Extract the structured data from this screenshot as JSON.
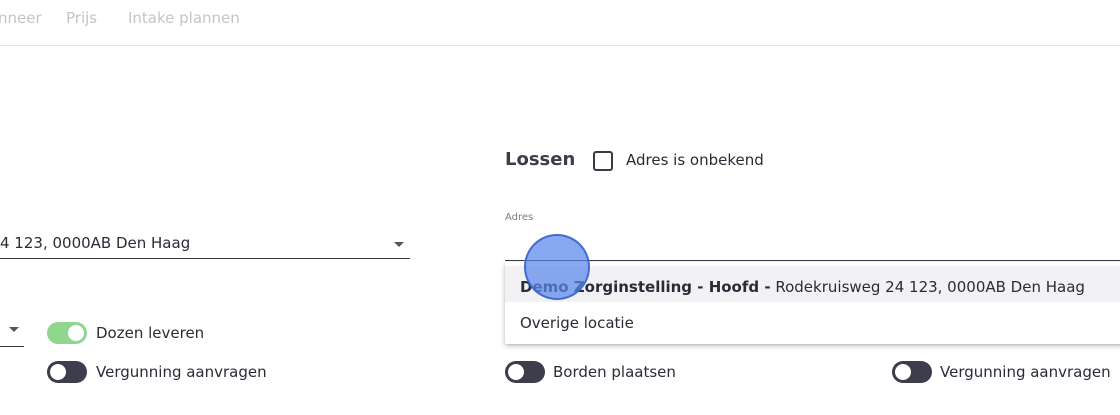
{
  "nav": {
    "items": [
      "nneer",
      "Prijs",
      "Intake plannen"
    ]
  },
  "left": {
    "address_value": "4 123, 0000AB Den Haag",
    "toggle_dozen": {
      "label": "Dozen leveren",
      "on": true
    },
    "toggle_vergunning": {
      "label": "Vergunning aanvragen",
      "on": false
    }
  },
  "lossen": {
    "title": "Lossen",
    "checkbox_label": "Adres is onbekend",
    "checkbox_checked": false,
    "address_label": "Adres",
    "dropdown": {
      "options": [
        {
          "bold": "Demo Zorginstelling - Hoofd -",
          "rest": "Rodekruisweg 24 123, 0000AB Den Haag"
        },
        {
          "bold": "",
          "rest": "Overige locatie"
        }
      ]
    },
    "toggle_borden": {
      "label": "Borden plaatsen",
      "on": false
    },
    "toggle_vergunning": {
      "label": "Vergunning aanvragen",
      "on": false
    }
  },
  "colors": {
    "toggle_on": "#8fd68f",
    "toggle_off": "#3d3d4d",
    "cursor": "#5a87eb"
  }
}
